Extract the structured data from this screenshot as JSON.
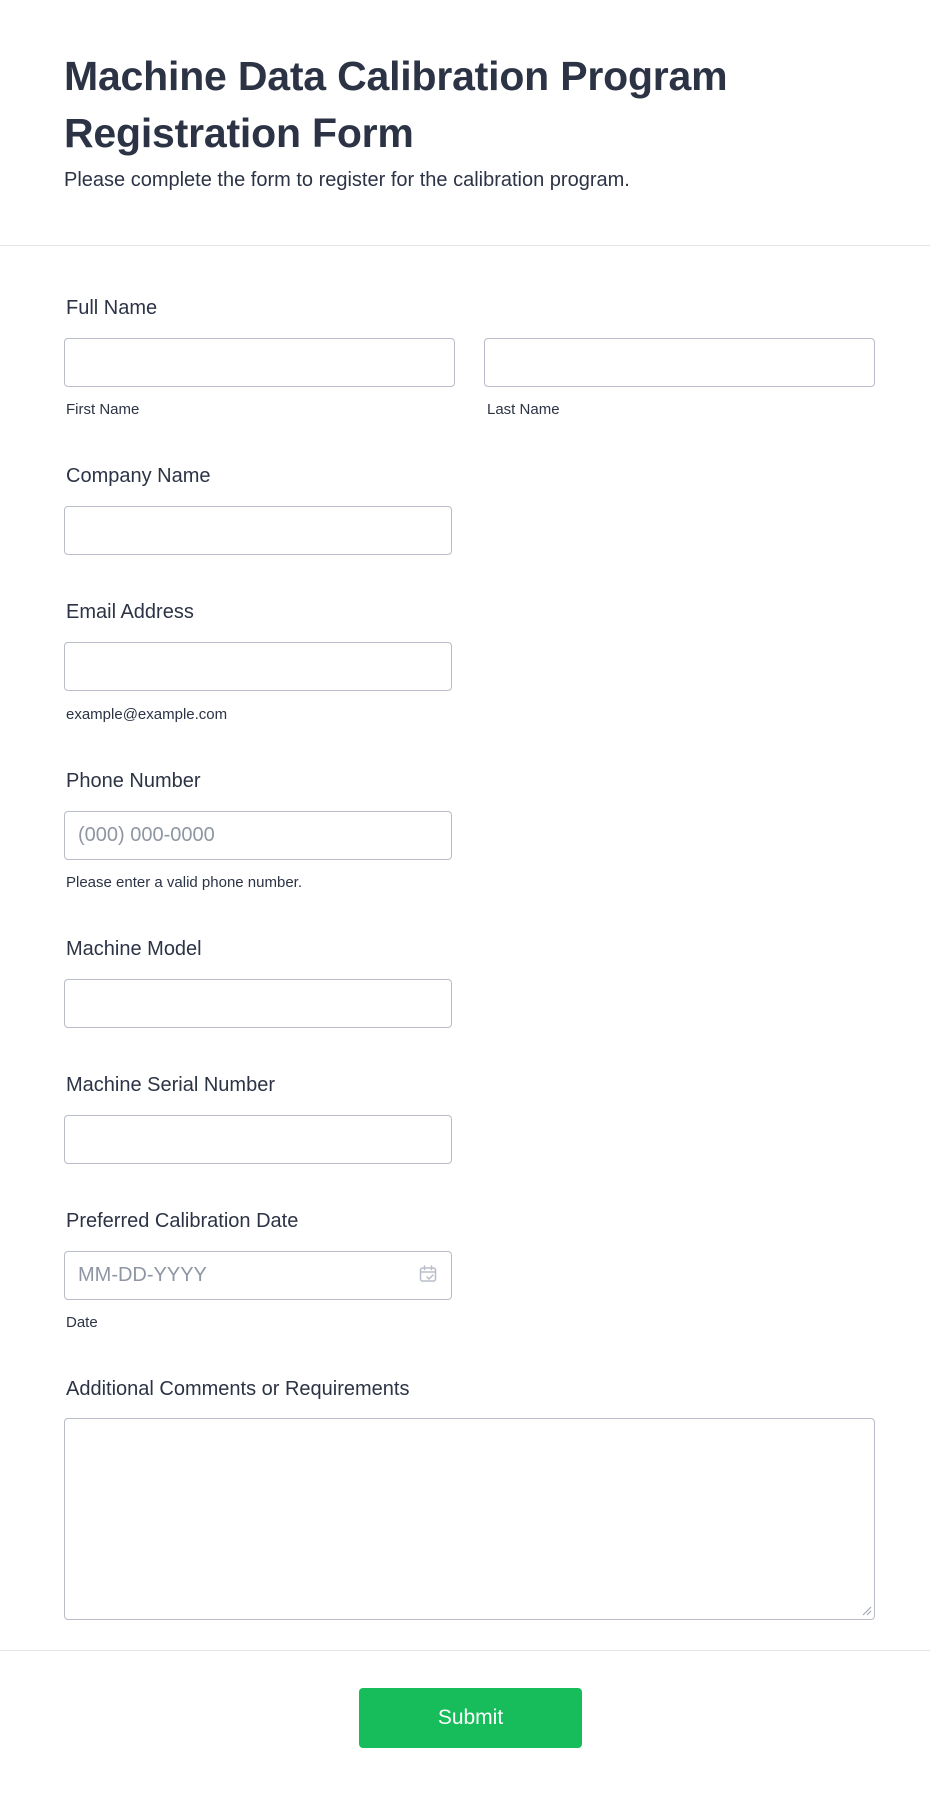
{
  "form": {
    "title": "Machine Data Calibration Program Registration Form",
    "subtitle": "Please complete the form to register for the calibration program."
  },
  "fields": {
    "full_name": {
      "label": "Full Name",
      "first": {
        "value": "",
        "sublabel": "First Name"
      },
      "last": {
        "value": "",
        "sublabel": "Last Name"
      }
    },
    "company": {
      "label": "Company Name",
      "value": ""
    },
    "email": {
      "label": "Email Address",
      "value": "",
      "sublabel": "example@example.com"
    },
    "phone": {
      "label": "Phone Number",
      "value": "",
      "placeholder": "(000) 000-0000",
      "sublabel": "Please enter a valid phone number."
    },
    "machine_model": {
      "label": "Machine Model",
      "value": ""
    },
    "serial_number": {
      "label": "Machine Serial Number",
      "value": ""
    },
    "calibration_date": {
      "label": "Preferred Calibration Date",
      "value": "",
      "placeholder": "MM-DD-YYYY",
      "sublabel": "Date",
      "icon": "calendar-check-icon"
    },
    "comments": {
      "label": "Additional Comments or Requirements",
      "value": ""
    }
  },
  "submit": {
    "label": "Submit",
    "color": "#18bd5b"
  },
  "colors": {
    "text": "#2c3345",
    "border": "#b8bdc9",
    "placeholder": "#8f96a3",
    "divider": "#e3e5ea"
  }
}
